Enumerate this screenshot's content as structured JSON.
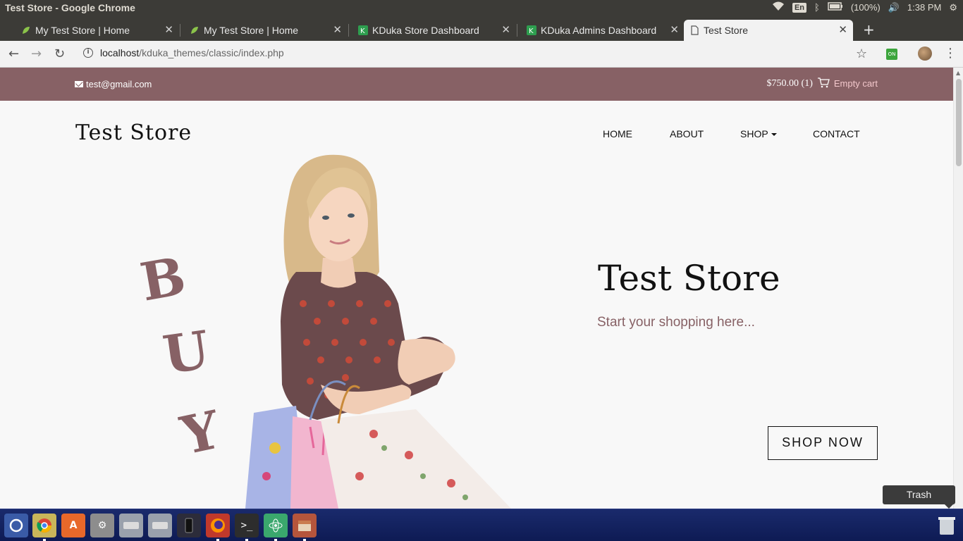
{
  "os": {
    "window_title": "Test Store - Google Chrome",
    "lang": "En",
    "battery": "(100%)",
    "time": "1:38 PM"
  },
  "browser": {
    "tabs": [
      {
        "label": "My Test Store | Home",
        "icon": "leaf-icon"
      },
      {
        "label": "My Test Store | Home",
        "icon": "leaf-icon"
      },
      {
        "label": "KDuka Store Dashboard",
        "icon": "kduka-icon"
      },
      {
        "label": "KDuka Admins Dashboard",
        "icon": "kduka-icon"
      },
      {
        "label": "Test Store",
        "icon": "page-icon",
        "active": true
      }
    ],
    "url_host": "localhost",
    "url_path": "/kduka_themes/classic/index.php",
    "extension_label": "ON"
  },
  "site": {
    "email": "test@gmail.com",
    "cart_total": "$750.00 (1)",
    "cart_empty": "Empty cart",
    "brand": "Test Store",
    "nav": [
      "HOME",
      "ABOUT",
      "SHOP",
      "CONTACT"
    ],
    "hero_letters": [
      "B",
      "U",
      "Y"
    ],
    "hero_title": "Test Store",
    "hero_subtitle": "Start your shopping here...",
    "cta": "SHOP NOW",
    "colors": {
      "accent": "#876165",
      "background": "#f8f8f8"
    }
  },
  "dock": {
    "tooltip": "Trash",
    "items": [
      "ubuntu-icon",
      "chrome-icon",
      "software-center-icon",
      "settings-icon",
      "drive-icon",
      "drive-icon",
      "phone-icon",
      "firefox-icon",
      "terminal-icon",
      "atom-icon",
      "archive-icon"
    ]
  }
}
